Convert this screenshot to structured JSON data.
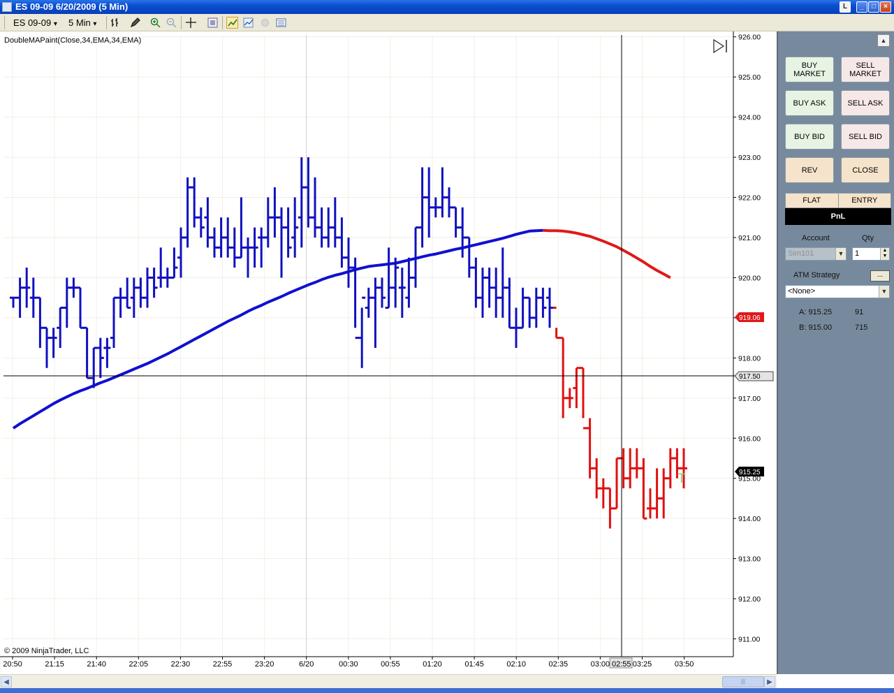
{
  "window": {
    "title": "ES 09-09  6/20/2009 (5 Min)",
    "buttons": [
      "L",
      "_",
      "□",
      "×"
    ]
  },
  "toolbar": {
    "instrument": "ES 09-09",
    "interval": "5 Min",
    "dropdown_glyph": "▾"
  },
  "chart": {
    "indicator_label": "DoubleMAPaint(Close,34,EMA,34,EMA)",
    "copyright": "© 2009 NinjaTrader, LLC",
    "colors": {
      "up": "#1010c0",
      "down": "#e01010",
      "ma_rising": "#1010d0",
      "ma_falling": "#e01818"
    },
    "crosshair_price_label": "917.50",
    "crosshair_time_label": "02:55",
    "last_price_label": "915.25",
    "ma_value_label": "919.06",
    "order_marker": "T"
  },
  "chart_data": {
    "type": "ohlc",
    "y_axis": {
      "ylim": [
        910.8,
        926.1
      ],
      "tick_labels": [
        "926.00",
        "925.00",
        "924.00",
        "923.00",
        "922.00",
        "921.00",
        "920.00",
        "919.00",
        "918.00",
        "917.00",
        "916.00",
        "915.00",
        "914.00",
        "913.00",
        "912.00",
        "911.00"
      ]
    },
    "x_axis": {
      "tick_labels": [
        "20:50",
        "21:15",
        "21:40",
        "22:05",
        "22:30",
        "22:55",
        "23:20",
        "6/20",
        "00:30",
        "00:55",
        "01:20",
        "01:45",
        "02:10",
        "02:35",
        "03:00",
        "03:25",
        "03:50"
      ]
    },
    "bars": [
      [
        919.5,
        919.5,
        919.25,
        919.5
      ],
      [
        919.5,
        920.0,
        919.0,
        919.75
      ],
      [
        919.75,
        920.25,
        919.25,
        919.75
      ],
      [
        919.5,
        920.0,
        919.0,
        919.5
      ],
      [
        919.5,
        919.5,
        918.25,
        918.75
      ],
      [
        918.75,
        918.75,
        917.75,
        918.5
      ],
      [
        918.5,
        918.75,
        918.0,
        918.5
      ],
      [
        918.75,
        919.25,
        918.25,
        919.25
      ],
      [
        919.25,
        920.0,
        918.75,
        919.75
      ],
      [
        919.75,
        920.0,
        919.5,
        919.75
      ],
      [
        919.75,
        919.75,
        918.75,
        918.75
      ],
      [
        918.75,
        918.75,
        917.5,
        917.5
      ],
      [
        917.5,
        918.25,
        917.25,
        918.25
      ],
      [
        918.25,
        918.5,
        917.5,
        918.0
      ],
      [
        918.25,
        918.5,
        917.75,
        918.25
      ],
      [
        918.5,
        919.5,
        918.25,
        919.5
      ],
      [
        919.5,
        919.75,
        919.0,
        919.5
      ],
      [
        919.5,
        920.0,
        919.25,
        919.25
      ],
      [
        919.5,
        920.0,
        919.0,
        919.75
      ],
      [
        919.75,
        920.0,
        919.25,
        919.5
      ],
      [
        919.5,
        920.25,
        919.25,
        920.0
      ],
      [
        920.0,
        920.25,
        919.5,
        919.75
      ],
      [
        920.0,
        920.75,
        919.75,
        920.0
      ],
      [
        920.0,
        920.25,
        919.75,
        920.0
      ],
      [
        920.0,
        920.75,
        920.0,
        920.25
      ],
      [
        920.5,
        921.25,
        920.0,
        921.0
      ],
      [
        921.0,
        922.5,
        920.75,
        922.25
      ],
      [
        922.25,
        922.5,
        921.25,
        921.5
      ],
      [
        921.5,
        921.75,
        921.0,
        921.25
      ],
      [
        921.5,
        922.0,
        920.75,
        921.0
      ],
      [
        921.0,
        921.25,
        920.5,
        920.75
      ],
      [
        920.75,
        921.5,
        920.5,
        921.0
      ],
      [
        921.0,
        921.5,
        920.5,
        920.75
      ],
      [
        920.75,
        921.25,
        920.25,
        920.5
      ],
      [
        920.5,
        922.0,
        920.5,
        920.75
      ],
      [
        920.75,
        921.0,
        920.0,
        920.75
      ],
      [
        920.75,
        921.25,
        920.25,
        920.75
      ],
      [
        921.0,
        921.25,
        920.25,
        921.0
      ],
      [
        921.0,
        922.0,
        920.75,
        921.5
      ],
      [
        921.5,
        922.25,
        921.0,
        921.5
      ],
      [
        921.5,
        921.75,
        920.0,
        921.25
      ],
      [
        921.25,
        921.75,
        920.5,
        920.75
      ],
      [
        921.0,
        922.0,
        920.5,
        921.25
      ],
      [
        921.5,
        923.0,
        920.75,
        922.25
      ],
      [
        922.25,
        923.0,
        921.25,
        921.5
      ],
      [
        921.5,
        922.5,
        921.0,
        921.25
      ],
      [
        921.25,
        921.75,
        920.75,
        921.0
      ],
      [
        921.0,
        921.75,
        920.75,
        921.25
      ],
      [
        921.25,
        922.0,
        920.75,
        921.0
      ],
      [
        921.0,
        921.5,
        920.25,
        920.5
      ],
      [
        920.5,
        921.0,
        919.75,
        920.25
      ],
      [
        920.25,
        920.5,
        918.75,
        918.5
      ],
      [
        918.5,
        919.25,
        917.75,
        919.5
      ],
      [
        919.25,
        919.75,
        919.0,
        919.5
      ],
      [
        919.5,
        920.0,
        918.25,
        919.75
      ],
      [
        919.75,
        920.0,
        919.25,
        919.5
      ],
      [
        919.25,
        920.75,
        919.25,
        919.75
      ],
      [
        919.75,
        920.5,
        919.25,
        920.25
      ],
      [
        919.75,
        920.25,
        919.0,
        919.75
      ],
      [
        919.5,
        920.5,
        919.25,
        920.0
      ],
      [
        920.0,
        921.25,
        919.75,
        921.25
      ],
      [
        921.25,
        922.75,
        920.75,
        922.0
      ],
      [
        922.0,
        922.75,
        921.0,
        921.75
      ],
      [
        921.75,
        922.0,
        921.5,
        921.75
      ],
      [
        921.75,
        922.75,
        921.5,
        922.0
      ],
      [
        922.0,
        922.25,
        921.5,
        921.75
      ],
      [
        921.75,
        921.75,
        921.0,
        921.25
      ],
      [
        921.25,
        921.75,
        920.5,
        921.0
      ],
      [
        921.0,
        921.0,
        920.0,
        920.25
      ],
      [
        920.25,
        920.5,
        919.25,
        919.5
      ],
      [
        919.5,
        920.25,
        919.0,
        920.0
      ],
      [
        920.0,
        920.25,
        919.25,
        919.75
      ],
      [
        919.75,
        920.25,
        919.0,
        919.5
      ],
      [
        919.5,
        920.75,
        919.0,
        919.75
      ],
      [
        919.75,
        920.0,
        918.75,
        918.75
      ],
      [
        918.75,
        919.25,
        918.25,
        918.75
      ],
      [
        918.75,
        919.75,
        918.75,
        919.5
      ],
      [
        919.5,
        919.5,
        918.75,
        919.0
      ],
      [
        919.0,
        919.75,
        918.75,
        919.5
      ],
      [
        919.5,
        919.75,
        919.0,
        919.25
      ],
      [
        919.5,
        919.75,
        918.75,
        919.25
      ],
      [
        919.25,
        918.75,
        918.5,
        918.5
      ],
      [
        918.5,
        918.5,
        916.5,
        917.0
      ],
      [
        917.0,
        917.25,
        916.75,
        917.0
      ],
      [
        917.25,
        917.75,
        916.75,
        917.75
      ],
      [
        917.75,
        917.75,
        916.5,
        916.25
      ],
      [
        916.25,
        916.5,
        915.0,
        915.25
      ],
      [
        915.25,
        915.5,
        914.5,
        914.75
      ],
      [
        914.75,
        915.0,
        914.25,
        914.75
      ],
      [
        914.75,
        914.75,
        913.75,
        914.25
      ],
      [
        914.25,
        915.5,
        914.25,
        915.5
      ],
      [
        915.5,
        915.75,
        914.75,
        915.0
      ],
      [
        915.0,
        915.75,
        914.75,
        915.25
      ],
      [
        915.25,
        915.75,
        915.0,
        915.25
      ],
      [
        915.25,
        915.5,
        914.0,
        914.0
      ],
      [
        914.25,
        914.75,
        914.0,
        914.25
      ],
      [
        914.25,
        915.25,
        914.0,
        914.5
      ],
      [
        914.5,
        915.25,
        914.0,
        915.0
      ],
      [
        915.0,
        915.75,
        914.75,
        915.5
      ],
      [
        915.5,
        915.75,
        915.0,
        915.25
      ],
      [
        915.25,
        915.75,
        914.75,
        915.25
      ]
    ],
    "ma": [
      916.25,
      916.36,
      916.46,
      916.56,
      916.66,
      916.76,
      916.86,
      916.95,
      917.03,
      917.11,
      917.18,
      917.24,
      917.31,
      917.38,
      917.44,
      917.51,
      917.58,
      917.65,
      917.72,
      917.79,
      917.86,
      917.94,
      918.02,
      918.1,
      918.19,
      918.28,
      918.37,
      918.46,
      918.55,
      918.64,
      918.73,
      918.82,
      918.91,
      918.99,
      919.07,
      919.16,
      919.24,
      919.31,
      919.39,
      919.46,
      919.53,
      919.61,
      919.68,
      919.75,
      919.82,
      919.88,
      919.95,
      920.01,
      920.06,
      920.1,
      920.15,
      920.2,
      920.24,
      920.28,
      920.3,
      920.32,
      920.34,
      920.36,
      920.4,
      920.44,
      920.48,
      920.52,
      920.56,
      920.59,
      920.63,
      920.67,
      920.71,
      920.74,
      920.78,
      920.82,
      920.86,
      920.9,
      920.94,
      920.98,
      921.03,
      921.08,
      921.12,
      921.16,
      921.17,
      921.18,
      921.17,
      921.17,
      921.16,
      921.14,
      921.11,
      921.07,
      921.03,
      920.97,
      920.91,
      920.84,
      920.77,
      920.68,
      920.59,
      920.49,
      920.39,
      920.28,
      920.18,
      920.09,
      920.0
    ]
  },
  "order_panel": {
    "buy_market": "BUY\nMARKET",
    "sell_market": "SELL\nMARKET",
    "buy_ask": "BUY ASK",
    "sell_ask": "SELL ASK",
    "buy_bid": "BUY BID",
    "sell_bid": "SELL BID",
    "rev": "REV",
    "close": "CLOSE",
    "flat": "FLAT",
    "entry": "ENTRY",
    "pnl": "PnL",
    "account_label": "Account",
    "account_value": "Sim101",
    "qty_label": "Qty",
    "qty_value": "1",
    "atm_label": "ATM Strategy",
    "atm_button": "...",
    "atm_value": "<None>",
    "ask_label": "A: 915.25",
    "ask_size": "91",
    "bid_label": "B: 915.00",
    "bid_size": "715",
    "collapse_glyph": "▲"
  }
}
